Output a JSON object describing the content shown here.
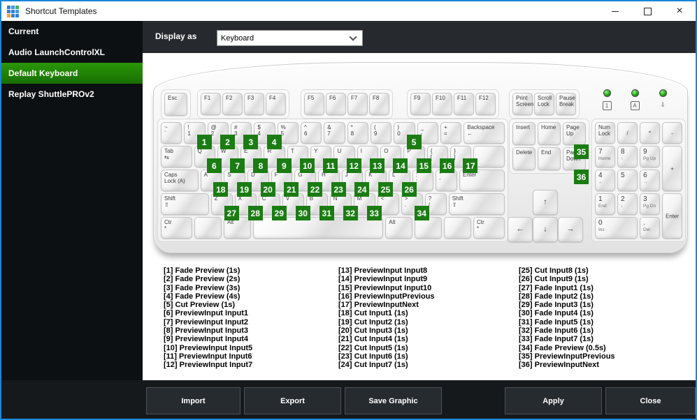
{
  "titlebar": {
    "title": "Shortcut Templates"
  },
  "sidebar": {
    "items": [
      {
        "label": "Current",
        "selected": false
      },
      {
        "label": "Audio LaunchControlXL",
        "selected": false
      },
      {
        "label": "Default Keyboard",
        "selected": true
      },
      {
        "label": "Replay ShuttlePROv2",
        "selected": false
      }
    ]
  },
  "toolbar": {
    "display_as_label": "Display as",
    "display_as_value": "Keyboard"
  },
  "colors": {
    "window_border_blue": "#1886d9",
    "selected_template_green": "#1f8305",
    "shortcut_badge_green": "#1a7c12",
    "dark_panel": "#26292d",
    "footer_button_bg": "#262b30"
  },
  "keyboard": {
    "esc": {
      "id": "esc",
      "lines": [
        "Esc"
      ]
    },
    "function_groups": [
      {
        "name": "f1-f4",
        "keys": [
          {
            "id": "f1",
            "lines": [
              "F1"
            ]
          },
          {
            "id": "f2",
            "lines": [
              "F2"
            ]
          },
          {
            "id": "f3",
            "lines": [
              "F3"
            ]
          },
          {
            "id": "f4",
            "lines": [
              "F4"
            ]
          }
        ]
      },
      {
        "name": "f5-f8",
        "keys": [
          {
            "id": "f5",
            "lines": [
              "F5"
            ]
          },
          {
            "id": "f6",
            "lines": [
              "F6"
            ]
          },
          {
            "id": "f7",
            "lines": [
              "F7"
            ]
          },
          {
            "id": "f8",
            "lines": [
              "F8"
            ]
          }
        ]
      },
      {
        "name": "f9-f12",
        "keys": [
          {
            "id": "f9",
            "lines": [
              "F9"
            ]
          },
          {
            "id": "f10",
            "lines": [
              "F10"
            ]
          },
          {
            "id": "f11",
            "lines": [
              "F11"
            ]
          },
          {
            "id": "f12",
            "lines": [
              "F12"
            ]
          }
        ]
      },
      {
        "name": "system",
        "keys": [
          {
            "id": "print-screen",
            "lines": [
              "Print",
              "Screen"
            ]
          },
          {
            "id": "scroll-lock",
            "lines": [
              "Scroll",
              "Lock"
            ]
          },
          {
            "id": "pause-break",
            "lines": [
              "Pause",
              "Break"
            ]
          }
        ]
      }
    ],
    "leds": [
      {
        "name": "num-lock-led",
        "glyph": "1",
        "style": "box"
      },
      {
        "name": "caps-lock-led",
        "glyph": "A",
        "style": "box"
      },
      {
        "name": "scroll-lock-led",
        "glyph": "⇩",
        "style": "glyph"
      }
    ],
    "main_rows": [
      [
        {
          "id": "backquote",
          "lines": [
            "~",
            "`"
          ]
        },
        {
          "id": "1",
          "lines": [
            "!",
            "1"
          ],
          "badge": 1
        },
        {
          "id": "2",
          "lines": [
            "@",
            "2"
          ],
          "badge": 2
        },
        {
          "id": "3",
          "lines": [
            "#",
            "3"
          ],
          "badge": 3
        },
        {
          "id": "4",
          "lines": [
            "$",
            "4"
          ],
          "badge": 4
        },
        {
          "id": "5",
          "lines": [
            "%",
            "5"
          ]
        },
        {
          "id": "6",
          "lines": [
            "^",
            "6"
          ]
        },
        {
          "id": "7",
          "lines": [
            "&",
            "7"
          ]
        },
        {
          "id": "8",
          "lines": [
            "*",
            "8"
          ]
        },
        {
          "id": "9",
          "lines": [
            "(",
            "9"
          ]
        },
        {
          "id": "0",
          "lines": [
            ")",
            "0"
          ],
          "badge": 5
        },
        {
          "id": "minus",
          "lines": [
            "_",
            "-"
          ]
        },
        {
          "id": "equals",
          "lines": [
            "+",
            "="
          ]
        },
        {
          "id": "backspace",
          "lines": [
            "Backspace",
            "←"
          ],
          "w": 2
        }
      ],
      [
        {
          "id": "tab",
          "lines": [
            "Tab",
            "⇆"
          ],
          "w": 1.5
        },
        {
          "id": "q",
          "lines": [
            "Q"
          ],
          "badge": 6
        },
        {
          "id": "w",
          "lines": [
            "W"
          ],
          "badge": 7
        },
        {
          "id": "e",
          "lines": [
            "E"
          ],
          "badge": 8
        },
        {
          "id": "r",
          "lines": [
            "R"
          ],
          "badge": 9
        },
        {
          "id": "t",
          "lines": [
            "T"
          ],
          "badge": 10
        },
        {
          "id": "y",
          "lines": [
            "Y"
          ],
          "badge": 11
        },
        {
          "id": "u",
          "lines": [
            "U"
          ],
          "badge": 12
        },
        {
          "id": "i",
          "lines": [
            "I"
          ],
          "badge": 13
        },
        {
          "id": "o",
          "lines": [
            "O"
          ],
          "badge": 14
        },
        {
          "id": "p",
          "lines": [
            "P"
          ],
          "badge": 15
        },
        {
          "id": "lbracket",
          "lines": [
            "{",
            "["
          ],
          "badge": 16
        },
        {
          "id": "rbracket",
          "lines": [
            "}",
            "]"
          ],
          "badge": 17
        },
        {
          "id": "enter-upper",
          "lines": [],
          "w": 1.5
        }
      ],
      [
        {
          "id": "caps-lock",
          "lines": [
            "Caps",
            "Lock (A)"
          ],
          "w": 1.8
        },
        {
          "id": "a",
          "lines": [
            "A"
          ],
          "badge": 18
        },
        {
          "id": "s",
          "lines": [
            "S"
          ],
          "badge": 19
        },
        {
          "id": "d",
          "lines": [
            "D"
          ],
          "badge": 20
        },
        {
          "id": "f",
          "lines": [
            "F"
          ],
          "badge": 21
        },
        {
          "id": "g",
          "lines": [
            "G"
          ],
          "badge": 22
        },
        {
          "id": "h",
          "lines": [
            "H"
          ],
          "badge": 23
        },
        {
          "id": "j",
          "lines": [
            "J"
          ],
          "badge": 24
        },
        {
          "id": "k",
          "lines": [
            "K"
          ],
          "badge": 25
        },
        {
          "id": "l",
          "lines": [
            "L"
          ],
          "badge": 26
        },
        {
          "id": "semicolon",
          "lines": [
            ":",
            ";"
          ]
        },
        {
          "id": "quote",
          "lines": [
            "\"",
            "'"
          ]
        },
        {
          "id": "enter",
          "lines": [
            "Enter"
          ],
          "w": 2.2
        }
      ],
      [
        {
          "id": "shift-left",
          "lines": [
            "Shift",
            "⇧"
          ],
          "w": 2.3
        },
        {
          "id": "z",
          "lines": [
            "Z"
          ],
          "badge": 27
        },
        {
          "id": "x",
          "lines": [
            "X"
          ],
          "badge": 28
        },
        {
          "id": "c",
          "lines": [
            "C"
          ],
          "badge": 29
        },
        {
          "id": "v",
          "lines": [
            "V"
          ],
          "badge": 30
        },
        {
          "id": "b",
          "lines": [
            "B"
          ],
          "badge": 31
        },
        {
          "id": "n",
          "lines": [
            "N"
          ],
          "badge": 32
        },
        {
          "id": "m",
          "lines": [
            "M"
          ],
          "badge": 33
        },
        {
          "id": "comma",
          "lines": [
            "<",
            ","
          ]
        },
        {
          "id": "period",
          "lines": [
            ">",
            "."
          ],
          "badge": 34
        },
        {
          "id": "slash",
          "lines": [
            "?",
            "/"
          ]
        },
        {
          "id": "shift-right",
          "lines": [
            "Shift",
            "⇧"
          ],
          "w": 2.7
        }
      ],
      [
        {
          "id": "ctrl-left",
          "lines": [
            "Ctr",
            "*"
          ],
          "w": 1.4
        },
        {
          "id": "win-left",
          "lines": [],
          "w": 1.2
        },
        {
          "id": "alt-left",
          "lines": [
            "Alt"
          ],
          "w": 1.2
        },
        {
          "id": "space",
          "lines": [],
          "w": 6
        },
        {
          "id": "alt-right",
          "lines": [
            "Alt"
          ],
          "w": 1.2
        },
        {
          "id": "win-right",
          "lines": [],
          "w": 1.2
        },
        {
          "id": "menu",
          "lines": [],
          "w": 1.2
        },
        {
          "id": "ctrl-right",
          "lines": [
            "Ctr",
            "*"
          ],
          "w": 1.4
        }
      ]
    ],
    "nav_keys": [
      {
        "id": "insert",
        "lines": [
          "Insert"
        ]
      },
      {
        "id": "home",
        "lines": [
          "Home"
        ]
      },
      {
        "id": "page-up",
        "lines": [
          "Page",
          "Up"
        ],
        "badge": 35,
        "badgeCls": "below"
      },
      {
        "id": "delete",
        "lines": [
          "Delete"
        ]
      },
      {
        "id": "end",
        "lines": [
          "End"
        ]
      },
      {
        "id": "page-down",
        "lines": [
          "Page",
          "Down"
        ],
        "badge": 36,
        "badgeCls": "below"
      }
    ],
    "arrows": [
      {
        "id": "arrow-up",
        "glyph": "↑"
      },
      {
        "id": "arrow-left",
        "glyph": "←"
      },
      {
        "id": "arrow-down",
        "glyph": "↓"
      },
      {
        "id": "arrow-right",
        "glyph": "→"
      }
    ],
    "numpad": [
      {
        "id": "num-lock",
        "lines": [
          "Num",
          "Lock"
        ],
        "c": 1,
        "r": 1
      },
      {
        "id": "np-divide",
        "lines": [
          "/"
        ],
        "c": 2,
        "r": 1,
        "cls": "center"
      },
      {
        "id": "np-multiply",
        "lines": [
          "*"
        ],
        "c": 3,
        "r": 1,
        "cls": "center"
      },
      {
        "id": "np-subtract",
        "lines": [
          "-"
        ],
        "c": 4,
        "r": 1,
        "cls": "center"
      },
      {
        "id": "np-7",
        "lines": [
          "7",
          "Home"
        ],
        "c": 1,
        "r": 2,
        "cls": "np"
      },
      {
        "id": "np-8",
        "lines": [
          "8",
          "↑"
        ],
        "c": 2,
        "r": 2,
        "cls": "np"
      },
      {
        "id": "np-9",
        "lines": [
          "9",
          "Pg Up"
        ],
        "c": 3,
        "r": 2,
        "cls": "np"
      },
      {
        "id": "np-add",
        "lines": [
          "+"
        ],
        "c": 4,
        "r": 2,
        "rs": 2,
        "cls": "center"
      },
      {
        "id": "np-4",
        "lines": [
          "4",
          "←"
        ],
        "c": 1,
        "r": 3,
        "cls": "np"
      },
      {
        "id": "np-5",
        "lines": [
          "5"
        ],
        "c": 2,
        "r": 3,
        "cls": "np"
      },
      {
        "id": "np-6",
        "lines": [
          "6",
          "→"
        ],
        "c": 3,
        "r": 3,
        "cls": "np"
      },
      {
        "id": "np-1",
        "lines": [
          "1",
          "End"
        ],
        "c": 1,
        "r": 4,
        "cls": "np"
      },
      {
        "id": "np-2",
        "lines": [
          "2",
          "↓"
        ],
        "c": 2,
        "r": 4,
        "cls": "np"
      },
      {
        "id": "np-3",
        "lines": [
          "3",
          "Pg Dn"
        ],
        "c": 3,
        "r": 4,
        "cls": "np"
      },
      {
        "id": "np-enter",
        "lines": [
          "Enter"
        ],
        "c": 4,
        "r": 4,
        "rs": 2,
        "cls": "center"
      },
      {
        "id": "np-0",
        "lines": [
          "0",
          "Ins"
        ],
        "c": 1,
        "r": 5,
        "cs": 2,
        "cls": "np"
      },
      {
        "id": "np-decimal",
        "lines": [
          ".",
          "Del"
        ],
        "c": 3,
        "r": 5,
        "cls": "np"
      }
    ]
  },
  "shortcuts": {
    "columns": [
      [
        "[1] Fade Preview (1s)",
        "[2] Fade Preview (2s)",
        "[3] Fade Preview (3s)",
        "[4] Fade Preview (4s)",
        "[5] Cut Preview (1s)",
        "[6] PreviewInput Input1",
        "[7] PreviewInput Input2",
        "[8] PreviewInput Input3",
        "[9] PreviewInput Input4",
        "[10] PreviewInput Input5",
        "[11] PreviewInput Input6",
        "[12] PreviewInput Input7"
      ],
      [
        "[13] PreviewInput Input8",
        "[14] PreviewInput Input9",
        "[15] PreviewInput Input10",
        "[16] PreviewInputPrevious",
        "[17] PreviewInputNext",
        "[18] Cut Input1 (1s)",
        "[19] Cut Input2 (1s)",
        "[20] Cut Input3 (1s)",
        "[21] Cut Input4 (1s)",
        "[22] Cut Input5 (1s)",
        "[23] Cut Input6 (1s)",
        "[24] Cut Input7 (1s)"
      ],
      [
        "[25] Cut Input8 (1s)",
        "[26] Cut Input9 (1s)",
        "[27] Fade Input1 (1s)",
        "[28] Fade Input2 (1s)",
        "[29] Fade Input3 (1s)",
        "[30] Fade Input4 (1s)",
        "[31] Fade Input5 (1s)",
        "[32] Fade Input6 (1s)",
        "[33] Fade Input7 (1s)",
        "[34] Fade Preview (0.5s)",
        "[35] PreviewInputPrevious",
        "[36] PreviewInputNext"
      ]
    ]
  },
  "footer": {
    "buttons": [
      "Import",
      "Export",
      "Save Graphic",
      "Apply",
      "Close"
    ]
  }
}
